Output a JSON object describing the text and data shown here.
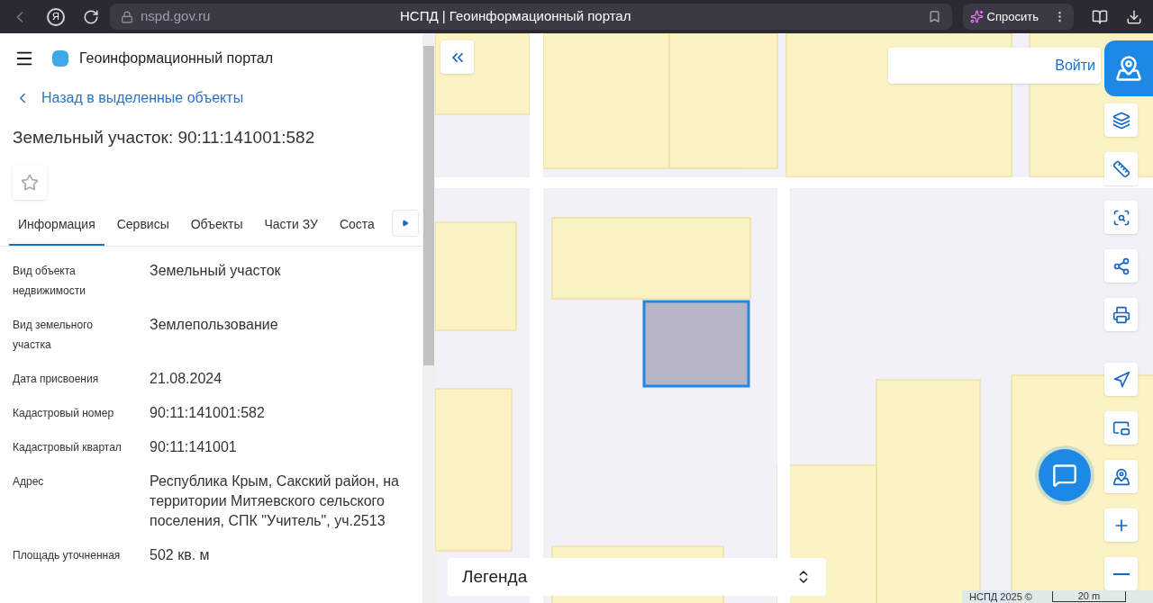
{
  "browser": {
    "logo_letter": "Я",
    "url": "nspd.gov.ru",
    "title": "НСПД | Геоинформационный портал",
    "ask_button": "Спросить"
  },
  "header": {
    "title": "Геоинформационный портал"
  },
  "back_link": "Назад в выделенные объекты",
  "object_title": "Земельный участок: 90:11:141001:582",
  "favorite": {
    "checked": false
  },
  "tabs": [
    {
      "label": "Информация",
      "selected": true
    },
    {
      "label": "Сервисы",
      "selected": false
    },
    {
      "label": "Объекты",
      "selected": false
    },
    {
      "label": "Части ЗУ",
      "selected": false
    },
    {
      "label": "Соста",
      "selected": false
    }
  ],
  "properties": [
    {
      "label": "Вид объекта недвижимости",
      "value": "Земельный участок"
    },
    {
      "label": "Вид земельного участка",
      "value": "Землепользование"
    },
    {
      "label": "Дата присвоения",
      "value": "21.08.2024"
    },
    {
      "label": "Кадастровый номер",
      "value": "90:11:141001:582"
    },
    {
      "label": "Кадастровый квартал",
      "value": "90:11:141001"
    },
    {
      "label": "Адрес",
      "value": "Республика Крым, Сакский район, на территории Митяевского сельского поселения, СПК \"Учитель\", уч.2513"
    },
    {
      "label": "Площадь уточненная",
      "value": "502 кв. м"
    }
  ],
  "map": {
    "login_button": "Войти",
    "legend": "Легенда",
    "attribution": "НСПД 2025 ©",
    "scale": "20 m"
  }
}
